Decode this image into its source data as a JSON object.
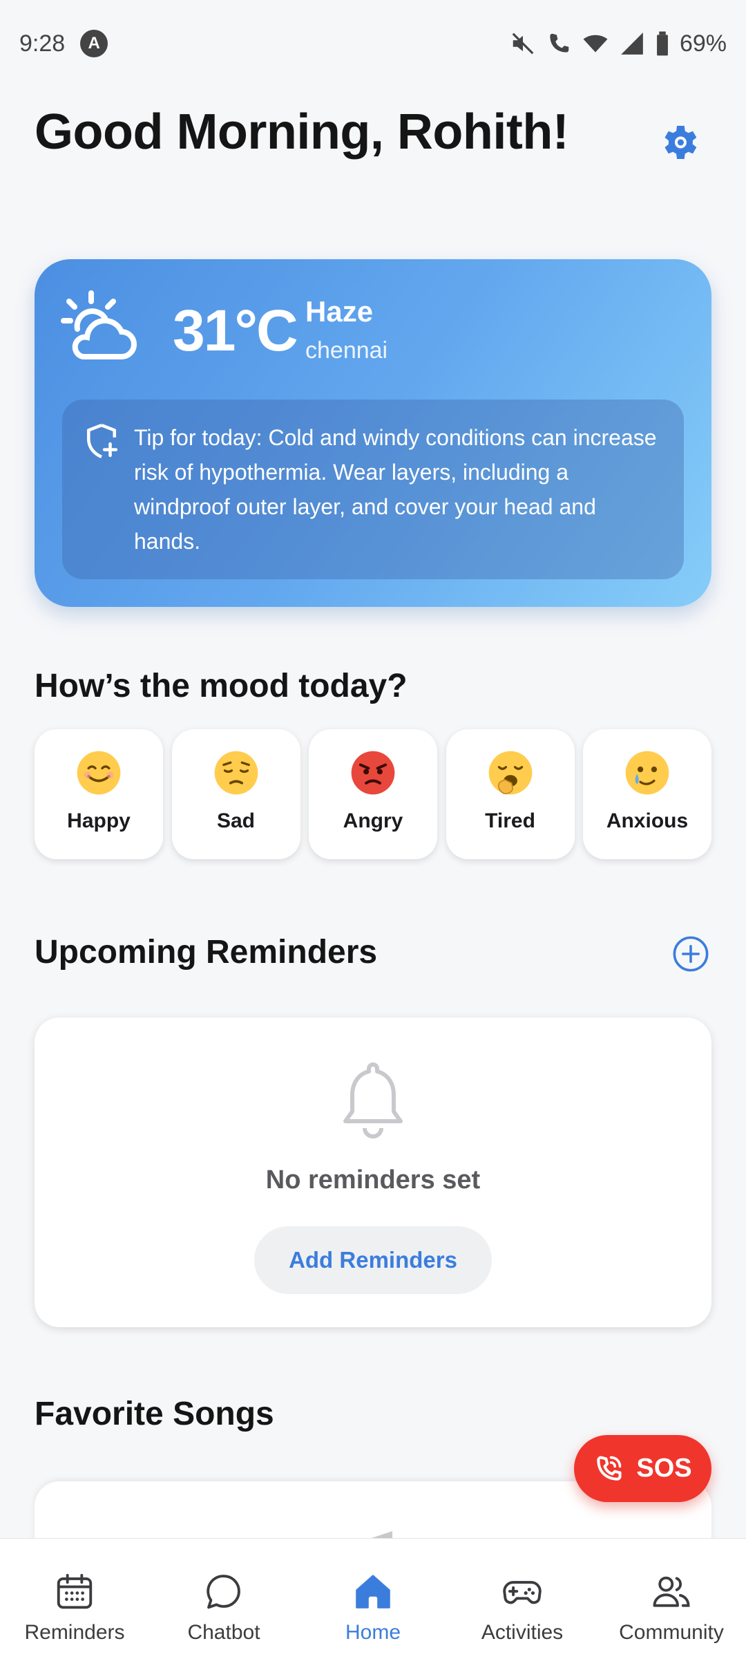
{
  "status_bar": {
    "time": "9:28",
    "notification_badge": "A",
    "battery": "69%",
    "icons": [
      "mute-icon",
      "wifi-calling-icon",
      "wifi-icon",
      "signal-icon",
      "battery-icon"
    ]
  },
  "header": {
    "greeting": "Good Morning, Rohith!",
    "settings_icon": "gear-icon"
  },
  "weather": {
    "temperature": "31°C",
    "condition": "Haze",
    "city": "chennai",
    "icon": "sun-cloud-icon",
    "tip": "Tip for today: Cold and windy conditions can increase risk of hypothermia. Wear layers, including a windproof outer layer, and cover your head and hands."
  },
  "mood": {
    "title": "How’s the mood today?",
    "options": [
      {
        "label": "Happy",
        "emoji": "😊"
      },
      {
        "label": "Sad",
        "emoji": "😔"
      },
      {
        "label": "Angry",
        "emoji": "😡"
      },
      {
        "label": "Tired",
        "emoji": "🥱"
      },
      {
        "label": "Anxious",
        "emoji": "🥲"
      }
    ]
  },
  "reminders": {
    "title": "Upcoming Reminders",
    "empty_text": "No reminders set",
    "add_button": "Add Reminders"
  },
  "songs": {
    "title": "Favorite Songs"
  },
  "sos": {
    "label": "SOS"
  },
  "nav": {
    "items": [
      {
        "label": "Reminders",
        "icon": "calendar-icon"
      },
      {
        "label": "Chatbot",
        "icon": "chat-bubble-icon"
      },
      {
        "label": "Home",
        "icon": "home-icon",
        "active": true
      },
      {
        "label": "Activities",
        "icon": "gamepad-icon"
      },
      {
        "label": "Community",
        "icon": "people-icon"
      }
    ]
  },
  "colors": {
    "accent": "#3b7ddd",
    "sos": "#f0352c",
    "weather_gradient_start": "#4c8fe2",
    "weather_gradient_end": "#86cdf9"
  }
}
